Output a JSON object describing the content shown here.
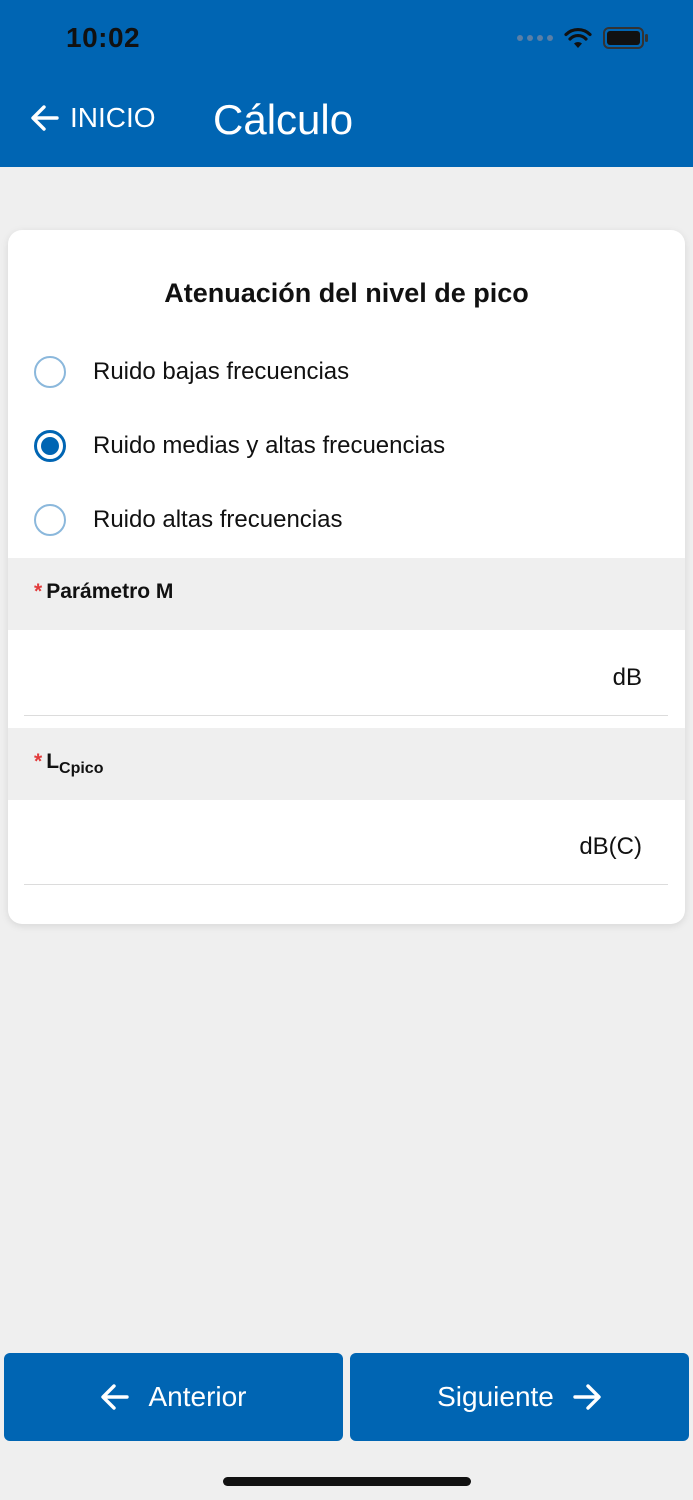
{
  "status_bar": {
    "time": "10:02"
  },
  "nav": {
    "back_label": "INICIO",
    "title": "Cálculo"
  },
  "card": {
    "title": "Atenuación del nivel de pico",
    "options": [
      {
        "label": "Ruido bajas frecuencias",
        "checked": false
      },
      {
        "label": "Ruido medias y altas frecuencias",
        "checked": true
      },
      {
        "label": "Ruido altas frecuencias",
        "checked": false
      }
    ],
    "field_m": {
      "required_mark": "*",
      "label": "Parámetro M",
      "value": "",
      "unit": "dB"
    },
    "field_l": {
      "required_mark": "*",
      "label_main": "L",
      "label_sub": "Cpico",
      "value": "",
      "unit": "dB(C)"
    }
  },
  "footer": {
    "prev_label": "Anterior",
    "next_label": "Siguiente"
  },
  "colors": {
    "primary": "#0065b3",
    "required": "#e23b3b",
    "background": "#efefef"
  }
}
